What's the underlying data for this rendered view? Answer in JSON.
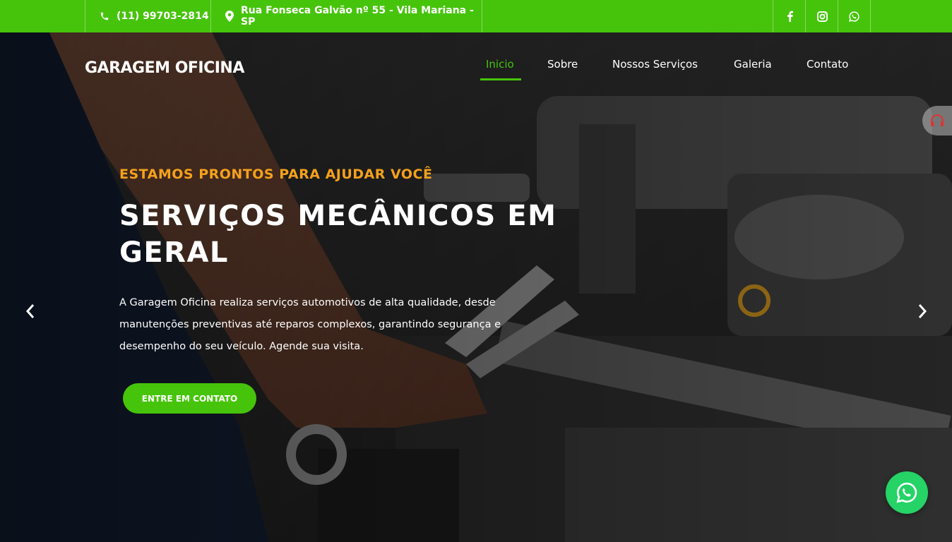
{
  "topbar": {
    "phone": "(11) 99703-2814",
    "address": "Rua Fonseca Galvão nº 55 - Vila Mariana - SP",
    "social": [
      "facebook-icon",
      "instagram-icon",
      "whatsapp-icon"
    ],
    "bg_color": "#46c40b"
  },
  "header": {
    "brand": "GARAGEM OFICINA",
    "nav": [
      {
        "label": "Inicio",
        "active": true
      },
      {
        "label": "Sobre"
      },
      {
        "label": "Nossos Serviços"
      },
      {
        "label": "Galeria"
      },
      {
        "label": "Contato"
      }
    ]
  },
  "hero": {
    "eyebrow": "ESTAMOS PRONTOS PARA AJUDAR VOCÊ",
    "title": "SERVIÇOS MECÂNICOS EM GERAL",
    "description": "A Garagem Oficina realiza serviços automotivos de alta qualidade, desde manutenções preventivas até reparos complexos, garantindo segurança e desempenho do seu veículo. Agende sua visita.",
    "cta_label": "ENTRE EM CONTATO",
    "accent_color": "#46c40b",
    "eyebrow_color": "#f5a11c"
  },
  "widgets": {
    "support_icon": "headset-icon",
    "whatsapp_float_icon": "whatsapp-icon"
  }
}
